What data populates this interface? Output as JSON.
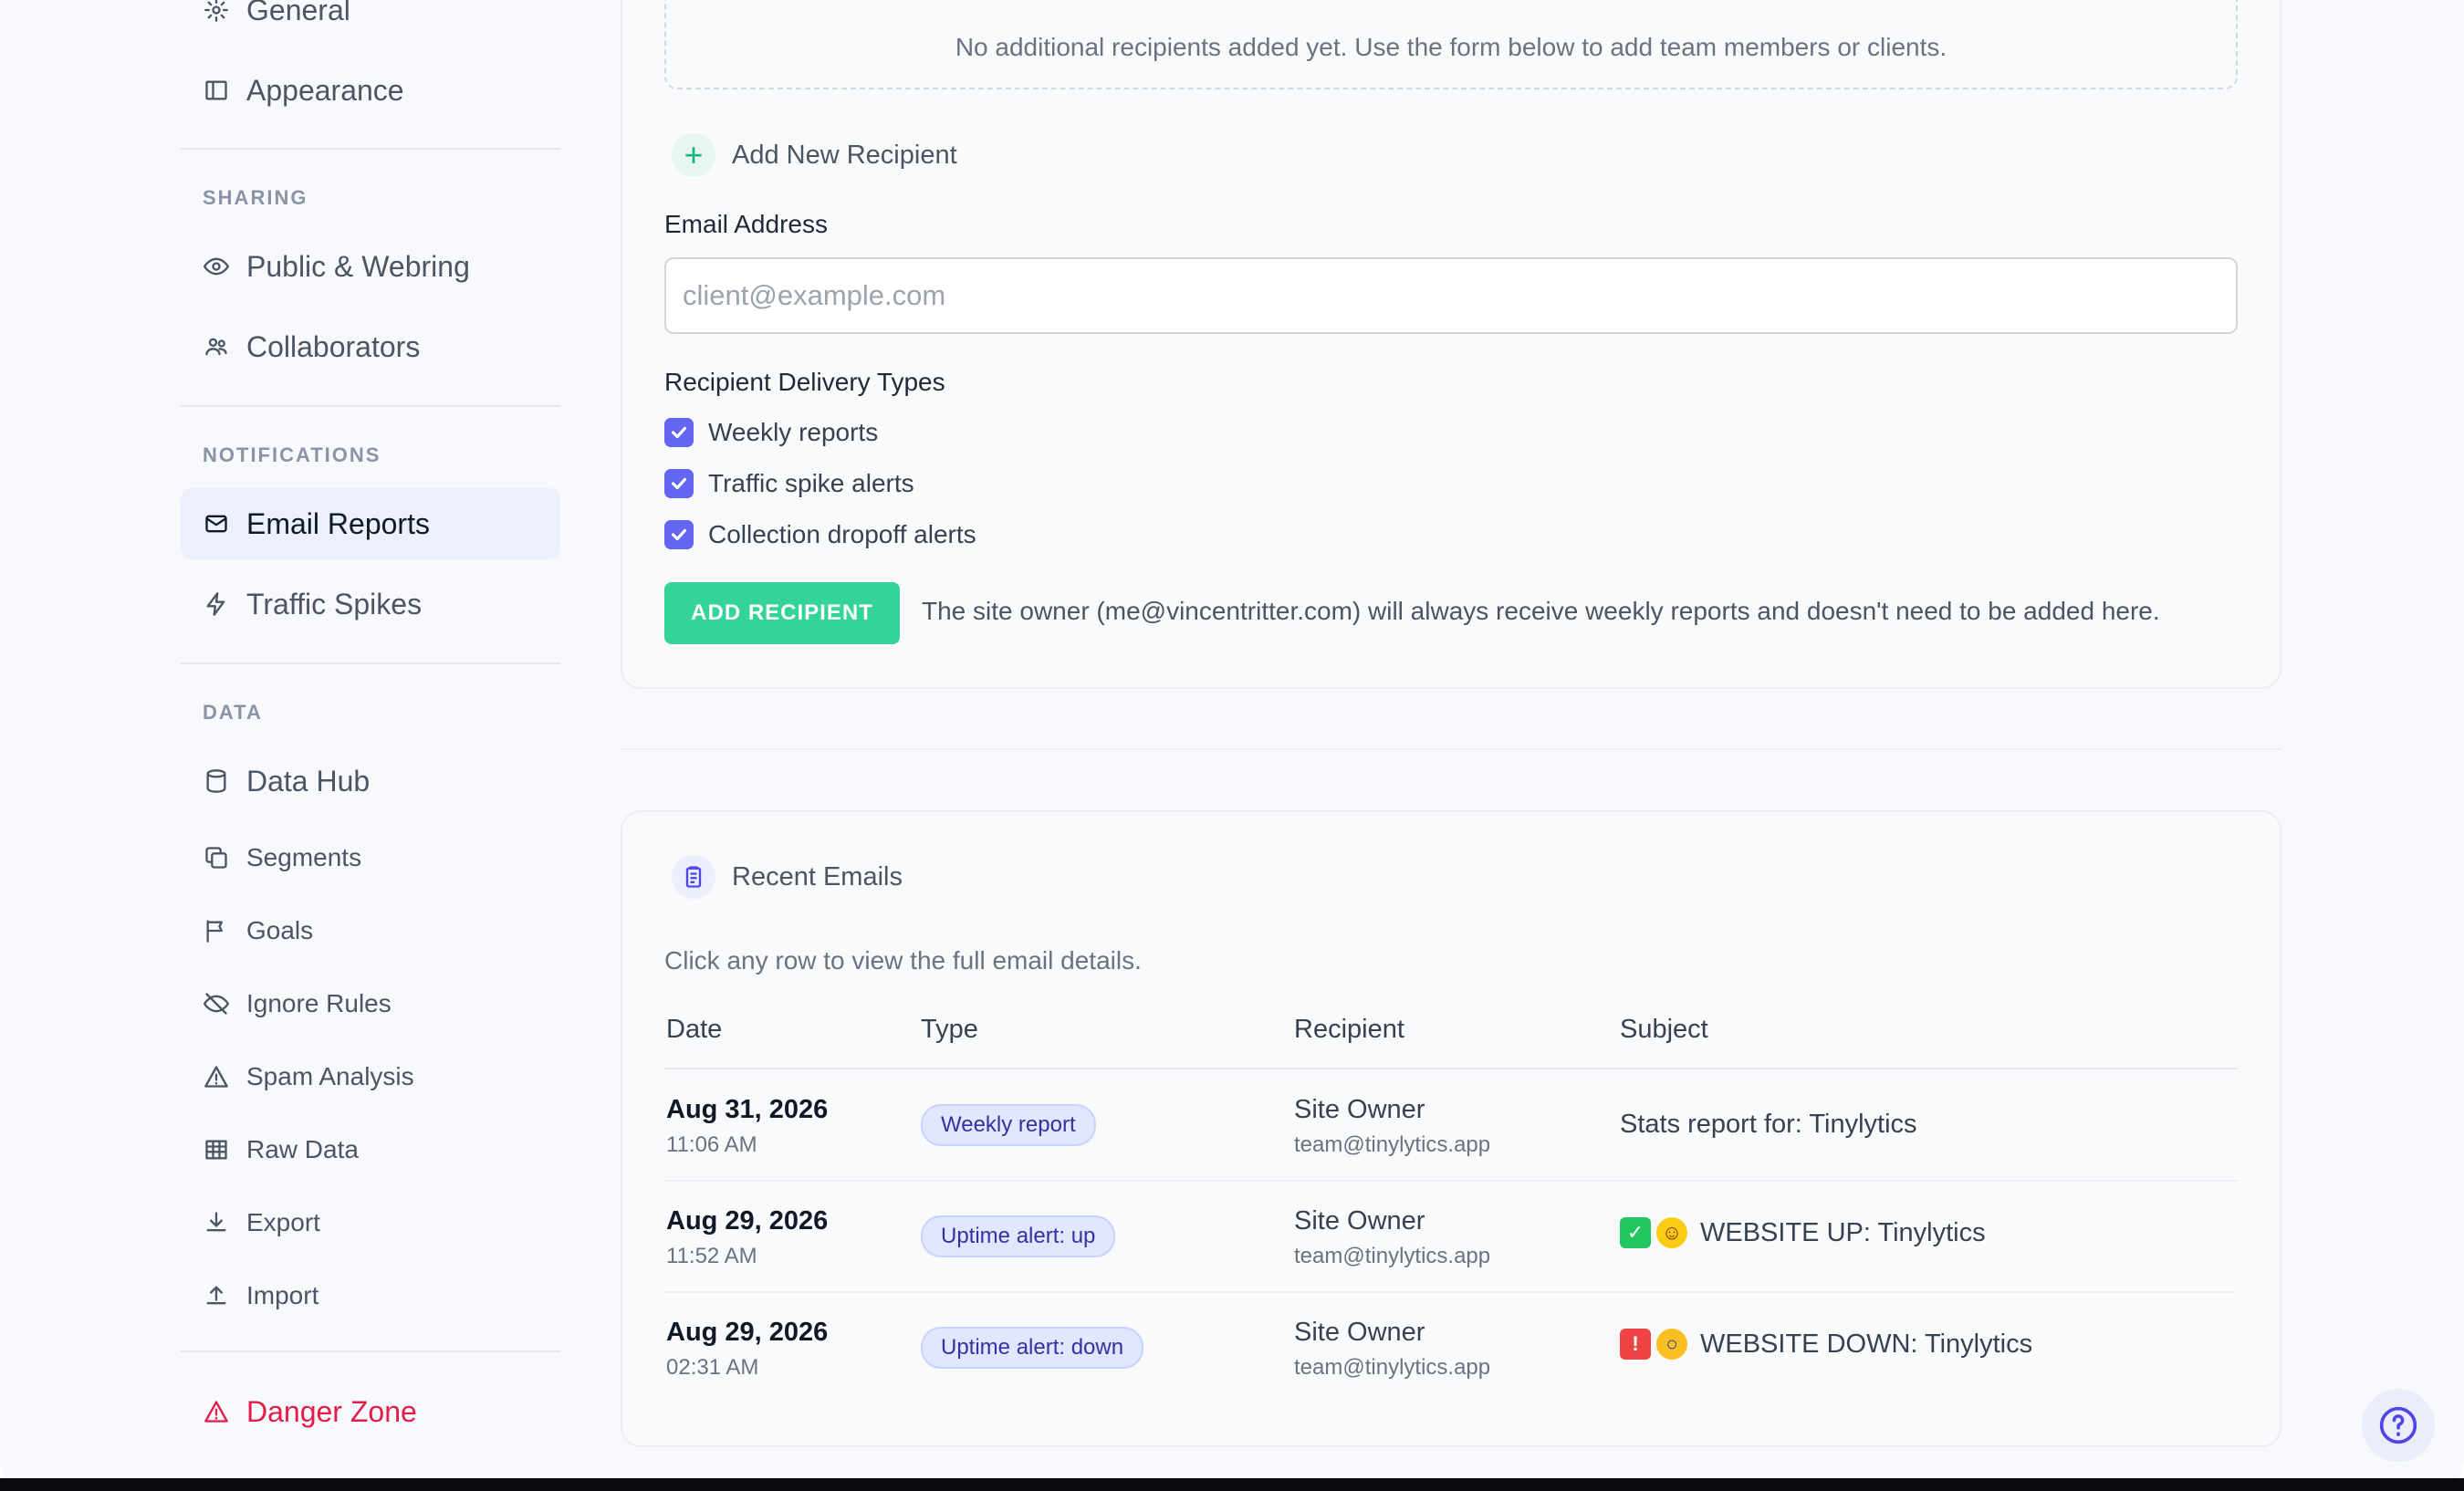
{
  "sidebar": {
    "items_top": [
      {
        "label": "General",
        "icon": "gear-icon"
      },
      {
        "label": "Appearance",
        "icon": "columns-icon"
      }
    ],
    "sections": {
      "sharing": "SHARING",
      "notifications": "NOTIFICATIONS",
      "data": "DATA"
    },
    "sharing_items": [
      {
        "label": "Public & Webring",
        "icon": "eye-icon"
      },
      {
        "label": "Collaborators",
        "icon": "users-icon"
      }
    ],
    "notification_items": [
      {
        "label": "Email Reports",
        "icon": "mail-icon",
        "active": true
      },
      {
        "label": "Traffic Spikes",
        "icon": "bolt-icon"
      }
    ],
    "data_items": [
      {
        "label": "Data Hub",
        "icon": "database-icon"
      },
      {
        "label": "Segments",
        "icon": "copy-icon"
      },
      {
        "label": "Goals",
        "icon": "flag-icon"
      },
      {
        "label": "Ignore Rules",
        "icon": "eye-off-icon"
      },
      {
        "label": "Spam Analysis",
        "icon": "warning-icon"
      },
      {
        "label": "Raw Data",
        "icon": "grid-icon"
      },
      {
        "label": "Export",
        "icon": "download-icon"
      },
      {
        "label": "Import",
        "icon": "upload-icon"
      }
    ],
    "danger": {
      "label": "Danger Zone",
      "icon": "warning-icon"
    }
  },
  "recipients": {
    "empty_text": "No additional recipients added yet. Use the form below to add team members or clients.",
    "add_heading": "Add New Recipient",
    "email_label": "Email Address",
    "email_placeholder": "client@example.com",
    "email_value": "",
    "delivery_label": "Recipient Delivery Types",
    "delivery_options": [
      {
        "label": "Weekly reports",
        "checked": true
      },
      {
        "label": "Traffic spike alerts",
        "checked": true
      },
      {
        "label": "Collection dropoff alerts",
        "checked": true
      }
    ],
    "add_button": "ADD RECIPIENT",
    "owner_note": "The site owner (me@vincentritter.com) will always receive weekly reports and doesn't need to be added here."
  },
  "recent": {
    "heading": "Recent Emails",
    "hint": "Click any row to view the full email details.",
    "columns": [
      "Date",
      "Type",
      "Recipient",
      "Subject"
    ],
    "rows": [
      {
        "date": "Aug 31, 2026",
        "time": "11:06 AM",
        "type": "Weekly report",
        "recipient": "Site Owner",
        "recipient_email": "team@tinylytics.app",
        "subject": "Stats report for: Tinylytics",
        "emoji": []
      },
      {
        "date": "Aug 29, 2026",
        "time": "11:52 AM",
        "type": "Uptime alert: up",
        "recipient": "Site Owner",
        "recipient_email": "team@tinylytics.app",
        "subject": "WEBSITE UP: Tinylytics",
        "emoji": [
          "check-mark-emoji",
          "smile-emoji"
        ]
      },
      {
        "date": "Aug 29, 2026",
        "time": "02:31 AM",
        "type": "Uptime alert: down",
        "recipient": "Site Owner",
        "recipient_email": "team@tinylytics.app",
        "subject": "WEBSITE DOWN: Tinylytics",
        "emoji": [
          "siren-emoji",
          "scream-emoji"
        ]
      }
    ]
  },
  "colors": {
    "accent": "#6366f1",
    "success": "#34d399",
    "danger": "#e11d48",
    "active_bg": "#ecf0fb"
  }
}
